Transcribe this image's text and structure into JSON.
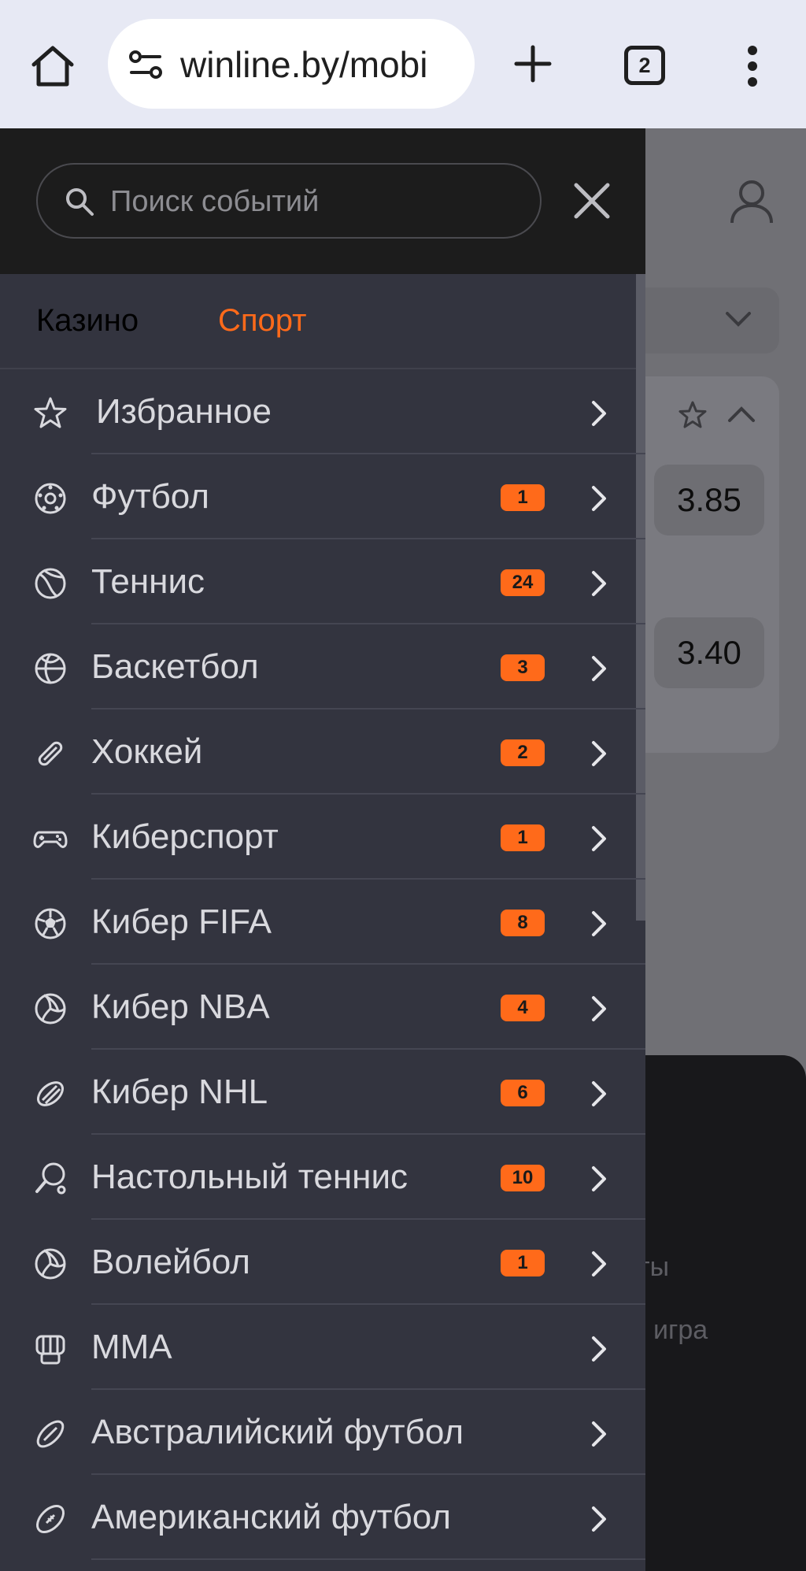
{
  "browser": {
    "url": "winline.by/mobi",
    "tab_count": "2"
  },
  "background": {
    "odds": [
      "3.85",
      "3.40"
    ],
    "text_fragment_1": "ты",
    "text_fragment_2": "игра"
  },
  "drawer": {
    "search_placeholder": "Поиск событий",
    "tabs": {
      "casino": "Казино",
      "sport": "Спорт"
    },
    "items": [
      {
        "label": "Избранное",
        "count": "",
        "icon": "star-icon"
      },
      {
        "label": "Футбол",
        "count": "1",
        "icon": "football-icon"
      },
      {
        "label": "Теннис",
        "count": "24",
        "icon": "tennis-icon"
      },
      {
        "label": "Баскетбол",
        "count": "3",
        "icon": "basketball-icon"
      },
      {
        "label": "Хоккей",
        "count": "2",
        "icon": "hockey-icon"
      },
      {
        "label": "Киберспорт",
        "count": "1",
        "icon": "gamepad-icon"
      },
      {
        "label": "Кибер FIFA",
        "count": "8",
        "icon": "soccer-ball-icon"
      },
      {
        "label": "Кибер NBA",
        "count": "4",
        "icon": "volleyball-icon"
      },
      {
        "label": "Кибер NHL",
        "count": "6",
        "icon": "hockey-puck-icon"
      },
      {
        "label": "Настольный теннис",
        "count": "10",
        "icon": "table-tennis-icon"
      },
      {
        "label": "Волейбол",
        "count": "1",
        "icon": "volleyball-icon"
      },
      {
        "label": "MMA",
        "count": "",
        "icon": "mma-glove-icon"
      },
      {
        "label": "Австралийский футбол",
        "count": "",
        "icon": "aussie-rules-ball-icon"
      },
      {
        "label": "Американский футбол",
        "count": "",
        "icon": "american-football-icon"
      }
    ]
  },
  "colors": {
    "accent": "#ff6a1a",
    "drawer_bg": "#33343f",
    "header_bg": "#1c1c1c"
  }
}
